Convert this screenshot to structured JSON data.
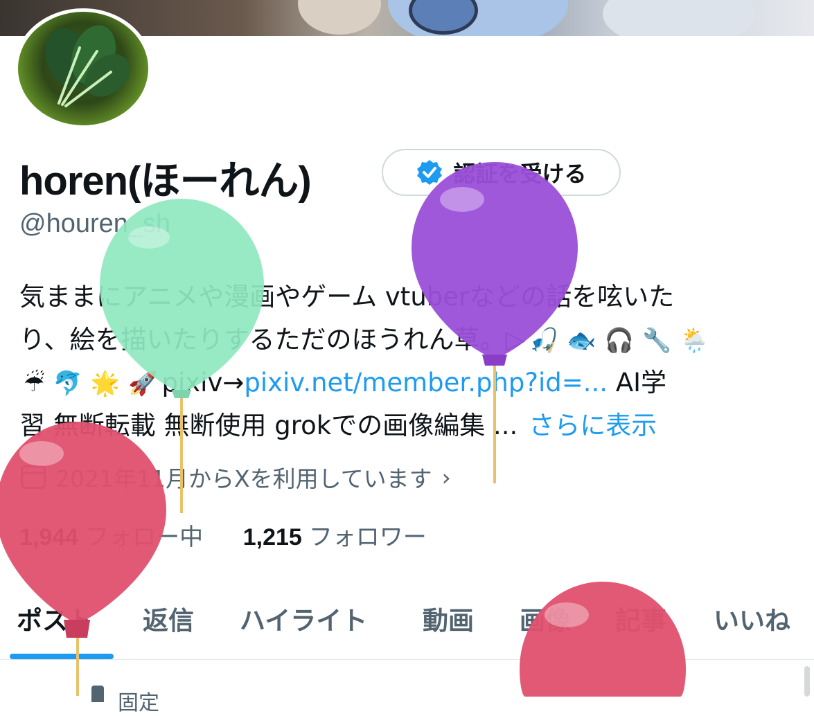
{
  "profile": {
    "display_name": "horen(ほーれん)",
    "handle": "@houren_sh",
    "verify_button_label": "認証を受ける",
    "bio": {
      "line1": "気ままにアニメや漫画やゲーム vtuberなどの話を呟いた",
      "line2": "り、絵を描いたりするただのほうれん草。▷",
      "line3_link_prefix": "pixiv→",
      "line3_link": "pixiv.net/member.php?id=...",
      "line3_suffix": " AI学",
      "line4": "習 無断転載 無断使用 grokでの画像編集 ...",
      "more_label": "さらに表示"
    },
    "emoji": {
      "line2": [
        "🎣",
        "🐟",
        "🎧",
        "🔧",
        "🌦️"
      ],
      "line3": [
        "☔",
        "🐬",
        "🌟",
        "🚀"
      ]
    },
    "joined": "2021年11月からXを利用しています",
    "following_count": "1,944",
    "following_label": "フォロー中",
    "followers_count": "1,215",
    "followers_label": "フォロワー"
  },
  "tabs": [
    "ポスト",
    "返信",
    "ハイライト",
    "動画",
    "画像",
    "記事",
    "いいね"
  ],
  "pinned_label": "固定",
  "colors": {
    "accent": "#1d9bf0",
    "text_primary": "#0f1419",
    "text_secondary": "#536471",
    "balloon_green": "#8ee8bf",
    "balloon_purple": "#9b4fd9",
    "balloon_pink": "#e0506f"
  }
}
